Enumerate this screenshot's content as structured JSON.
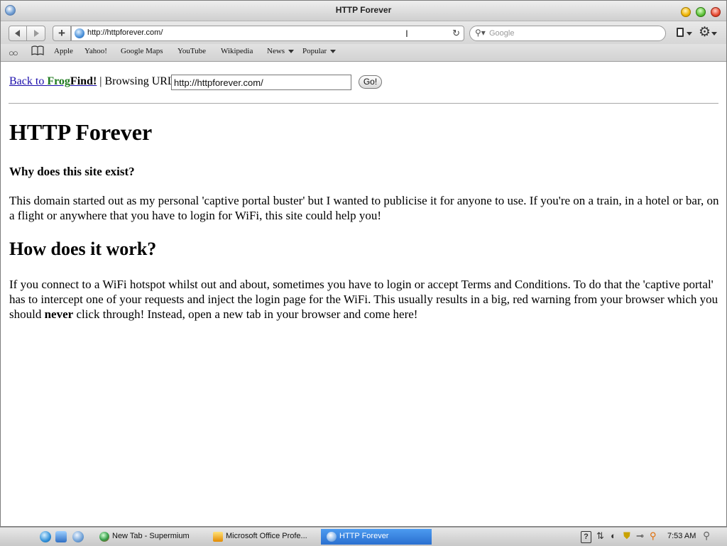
{
  "window": {
    "title": "HTTP Forever"
  },
  "toolbar": {
    "url": "http://httpforever.com/",
    "search_placeholder": "Google"
  },
  "bookmarks": {
    "items": [
      {
        "label": "Apple"
      },
      {
        "label": "Yahoo!"
      },
      {
        "label": "Google Maps"
      },
      {
        "label": "YouTube"
      },
      {
        "label": "Wikipedia"
      },
      {
        "label": "News"
      },
      {
        "label": "Popular"
      }
    ]
  },
  "page": {
    "back_link": {
      "prefix": "Back to ",
      "frog": "Frog",
      "find": "Find!"
    },
    "separator": " | Browsing URL:",
    "url_value": "http://httpforever.com/",
    "go_label": "Go!",
    "heading": "HTTP Forever",
    "subheading": "Why does this site exist?",
    "para1": "This domain started out as my personal 'captive portal buster' but I wanted to publicise it for anyone to use. If you're on a train, in a hotel or bar, on a flight or anywhere that you have to login for WiFi, this site could help you!",
    "heading2": "How does it work?",
    "para2_before": "If you connect to a WiFi hotspot whilst out and about, sometimes you have to login or accept Terms and Conditions. To do that the 'captive portal' has to intercept one of your requests and inject the login page for the WiFi. This usually results in a big, red warning from your browser which you should ",
    "para2_bold": "never",
    "para2_after": " click through! Instead, open a new tab in your browser and come here!"
  },
  "taskbar": {
    "tasks": [
      {
        "label": "New Tab - Supermium"
      },
      {
        "label": "Microsoft Office Profe..."
      },
      {
        "label": "HTTP Forever"
      }
    ],
    "help": "?",
    "clock": "7:53 AM"
  },
  "colors": {
    "link": "#1a0dab",
    "frog": "#1e7a1e",
    "active_task": "#2a6fd0"
  }
}
